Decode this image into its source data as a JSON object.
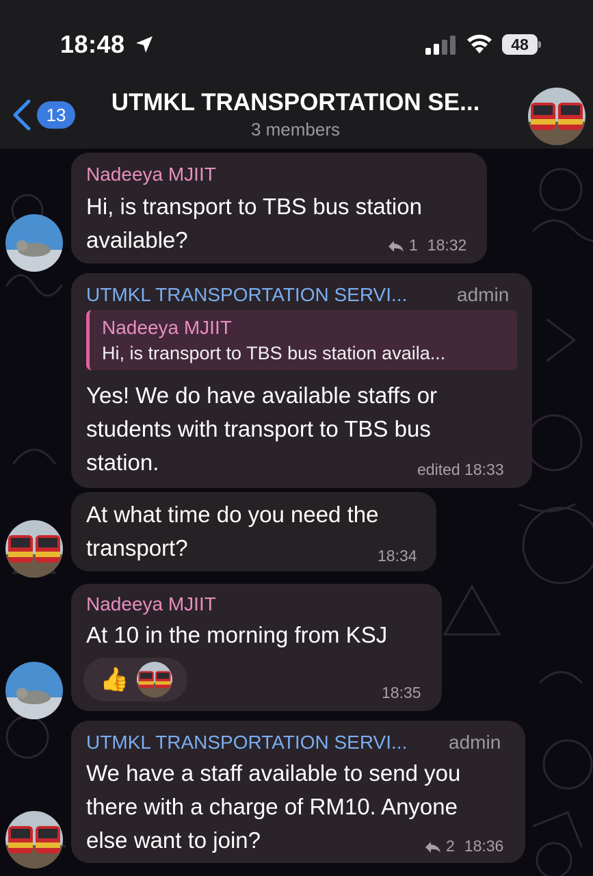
{
  "status_bar": {
    "time": "18:48",
    "battery": "48"
  },
  "header": {
    "back_count": "13",
    "title": "UTMKL TRANSPORTATION SE...",
    "subtitle": "3 members",
    "avatar_icon": "bus-avatar-icon"
  },
  "messages": [
    {
      "sender": "Nadeeya MJIIT",
      "text_lines": [
        "Hi, is transport to TBS bus station",
        "available?"
      ],
      "replies": "1",
      "time": "18:32"
    },
    {
      "sender": "UTMKL TRANSPORTATION SERVI...",
      "badge": "admin",
      "quote_sender": "Nadeeya MJIIT",
      "quote_text": "Hi, is transport to TBS bus station availa...",
      "text_lines": [
        "Yes! We do have available staffs or",
        "students with transport to TBS bus",
        "station."
      ],
      "time": "edited 18:33"
    },
    {
      "text_lines": [
        "At what time do you need the",
        "transport?"
      ],
      "time": "18:34"
    },
    {
      "sender": "Nadeeya MJIIT",
      "text_lines": [
        "At 10 in the morning from KSJ"
      ],
      "reaction": "👍",
      "time": "18:35"
    },
    {
      "sender": "UTMKL TRANSPORTATION SERVI...",
      "badge": "admin",
      "text_lines": [
        "We have a staff available to send you",
        "there with a charge of RM10. Anyone",
        "else want to join?"
      ],
      "replies": "2",
      "time": "18:36"
    }
  ],
  "colors": {
    "header_bg": "#1c1c1e",
    "bubble_bg": "#2a2329",
    "sender_pink": "#e88fbf",
    "sender_blue": "#7aaef0",
    "badge_blue": "#3a7be0"
  }
}
